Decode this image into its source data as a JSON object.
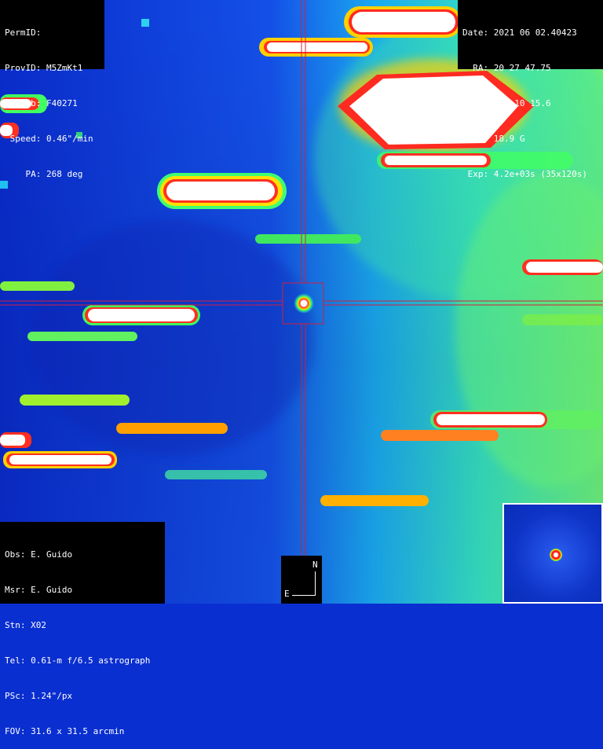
{
  "image": {
    "description_colors": {
      "background": "#0a2fd0",
      "star_core": "#ffffff",
      "star_rim": "#ff2020",
      "crosshair": "#d02040"
    },
    "center_marker_icon": "target-box-icon"
  },
  "top_left": {
    "perm_id": "PermID:",
    "prov_id": "ProvID: M5ZmKt1",
    "trk_sub": "TrkSub: F40271",
    "speed": " Speed: 0.46\"/min",
    "pa": "    PA: 268 deg"
  },
  "top_right": {
    "date": "Date: 2021 06 02.40423",
    "ra": "  RA: 20 27 47.75",
    "dec": " Dec: -51 10 15.6",
    "mag": " Mag: 18.9 G",
    "exp": " Exp: 4.2e+03s (35x120s)"
  },
  "bottom_left": {
    "obs": "Obs: E. Guido",
    "msr": "Msr: E. Guido",
    "stn": "Stn: X02",
    "tel": "Tel: 0.61-m f/6.5 astrograph",
    "psc": "PSc: 1.24\"/px",
    "fov": "FOV: 31.6 x 31.5 arcmin"
  },
  "compass": {
    "north": "N",
    "east": "E"
  }
}
